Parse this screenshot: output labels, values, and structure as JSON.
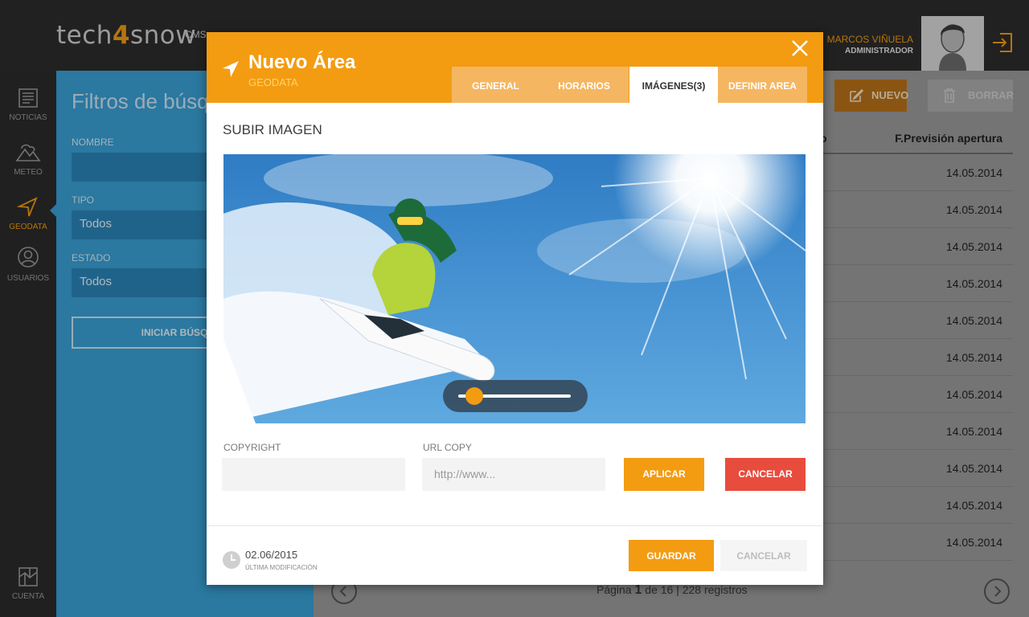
{
  "brand": {
    "logo_left": "tech",
    "logo_four": "4",
    "logo_right": "snow",
    "cms": "CMS"
  },
  "user": {
    "name": "MARCOS VIÑUELA",
    "role": "ADMINISTRADOR"
  },
  "sidebar": {
    "items": [
      {
        "label": "NOTICIAS",
        "icon": "newspaper-icon"
      },
      {
        "label": "METEO",
        "icon": "mountain-cloud-icon"
      },
      {
        "label": "GEODATA",
        "icon": "navigation-arrow-icon",
        "active": true
      },
      {
        "label": "USUARIOS",
        "icon": "user-icon"
      },
      {
        "label": "CUENTA",
        "icon": "map-icon"
      }
    ]
  },
  "filters": {
    "title": "Filtros de búsqueda",
    "nombre_label": "NOMBRE",
    "nombre_value": "",
    "tipo_label": "TIPO",
    "tipo_value": "Todos",
    "estado_label": "ESTADO",
    "estado_value": "Todos",
    "search_button": "INICIAR BÚSQUEDA"
  },
  "list": {
    "new_button": "NUEVO",
    "delete_button": "BORRAR",
    "column_header_left": "o",
    "column_header": "F.Previsión apertura",
    "rows": [
      "14.05.2014",
      "14.05.2014",
      "14.05.2014",
      "14.05.2014",
      "14.05.2014",
      "14.05.2014",
      "14.05.2014",
      "14.05.2014",
      "14.05.2014",
      "14.05.2014",
      "14.05.2014"
    ],
    "pager": {
      "prefix": "Página",
      "current": "1",
      "suffix": "de 16 | 228 registros"
    }
  },
  "modal": {
    "title": "Nuevo Área",
    "subtitle": "GEODATA",
    "tabs": [
      {
        "label": "GENERAL"
      },
      {
        "label": "HORARIOS"
      },
      {
        "label": "IMÁGENES(3)",
        "active": true
      },
      {
        "label": "DEFINIR AREA"
      }
    ],
    "section_title": "SUBIR IMAGEN",
    "slider_value": 0.14,
    "copyright_label": "COPYRIGHT",
    "copyright_value": "",
    "url_label": "URL COPY",
    "url_placeholder": "http://www...",
    "apply_button": "APLICAR",
    "cancel_button": "CANCELAR",
    "last_modified_date": "02.06/2015",
    "last_modified_label": "ÚLTIMA MODIFICACIÓN",
    "save_button": "GUARDAR",
    "footer_cancel_button": "CANCELAR"
  },
  "colors": {
    "accent": "#f39c12",
    "panel_blue": "#3aa0d6",
    "danger": "#e84c3d"
  }
}
